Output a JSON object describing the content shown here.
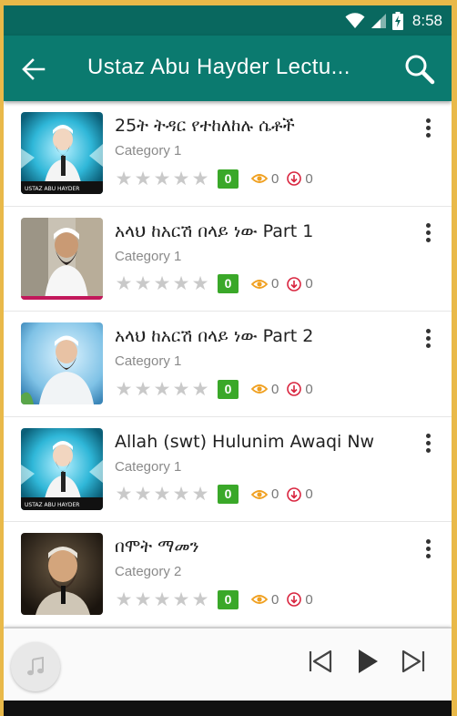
{
  "status_bar": {
    "time": "8:58",
    "icons": [
      "wifi-icon",
      "signal-icon",
      "battery-charging-icon"
    ]
  },
  "app_bar": {
    "title": "Ustaz Abu Hayder Lectu...",
    "back_icon": "arrow-left-icon",
    "search_icon": "search-icon"
  },
  "colors": {
    "status_bar": "#09685f",
    "app_bar": "#0b7a6f",
    "rating_badge": "#3aa829",
    "views_icon": "#f0a020",
    "downloads_icon": "#d9253f",
    "frame": "#e9b949"
  },
  "items": [
    {
      "title": "25ት ትዳር የተከለከሉ ሴቶች",
      "category": "Category 1",
      "rating": "0",
      "views": "0",
      "downloads": "0",
      "thumb_caption": "USTAZ ABU HAYDER"
    },
    {
      "title": "አላህ ከአርሽ በላይ ነው Part 1",
      "category": "Category 1",
      "rating": "0",
      "views": "0",
      "downloads": "0"
    },
    {
      "title": "አላህ ከአርሽ በላይ ነው Part 2",
      "category": "Category 1",
      "rating": "0",
      "views": "0",
      "downloads": "0"
    },
    {
      "title": "Allah (swt) Hulunim Awaqi Nw",
      "category": "Category 1",
      "rating": "0",
      "views": "0",
      "downloads": "0",
      "thumb_caption": "USTAZ ABU HAYDER"
    },
    {
      "title": "በሞት ማመን",
      "category": "Category 2",
      "rating": "0",
      "views": "0",
      "downloads": "0"
    }
  ],
  "player": {
    "art_icon": "music-note-icon",
    "controls": [
      "skip-previous-icon",
      "play-icon",
      "skip-next-icon"
    ]
  }
}
